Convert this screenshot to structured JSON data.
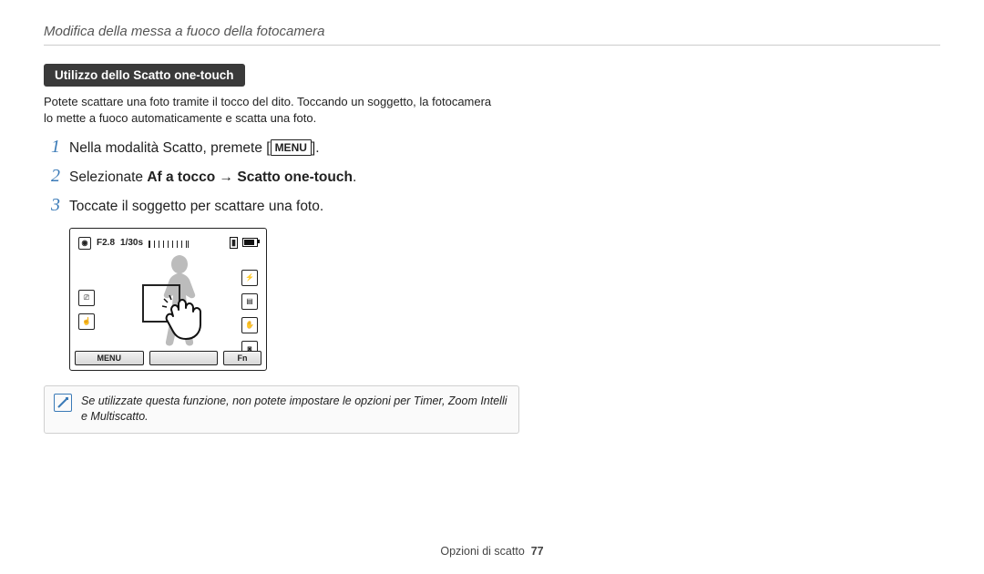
{
  "header": "Modifica della messa a fuoco della fotocamera",
  "section_title": "Utilizzo dello Scatto one-touch",
  "blurb": "Potete scattare una foto tramite il tocco del dito. Toccando un soggetto, la fotocamera lo mette a fuoco automaticamente e scatta una foto.",
  "steps": [
    {
      "num": "1",
      "pre": "Nella modalità Scatto, premete [",
      "menu": "MENU",
      "post": "]."
    },
    {
      "num": "2",
      "pre": "Selezionate ",
      "bold1": "Af a tocco",
      "arrow": " → ",
      "bold2": "Scatto one-touch",
      "post": "."
    },
    {
      "num": "3",
      "pre": "Toccate il soggetto per scattare una foto."
    }
  ],
  "camera": {
    "aperture": "F2.8",
    "shutter": "1/30s",
    "menu_label": "MENU",
    "fn_label": "Fn",
    "left_icons": [
      "off-icon",
      "touch-icon"
    ],
    "right_icons": [
      "flash-icon",
      "size-icon",
      "stabilize-icon",
      "meter-icon"
    ]
  },
  "note_text": "Se utilizzate questa funzione, non potete impostare le opzioni per Timer, Zoom Intelli e Multiscatto.",
  "footer_label": "Opzioni di scatto",
  "page_number": "77"
}
